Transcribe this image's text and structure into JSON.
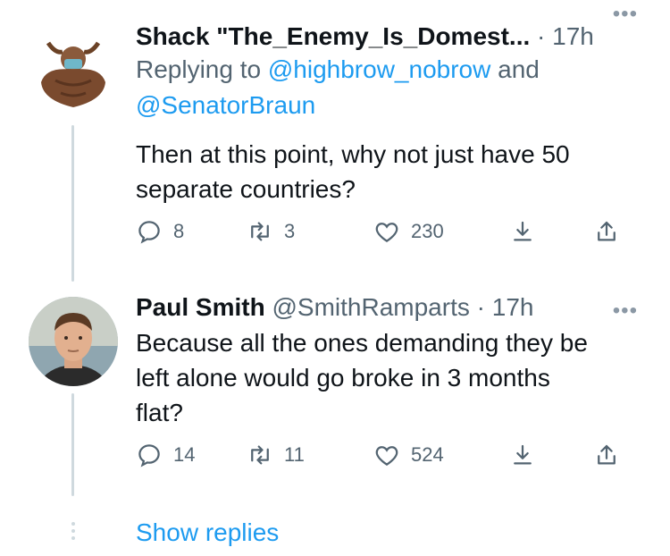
{
  "tweets": [
    {
      "display_name": "Shack \"The_Enemy_Is_Domest...",
      "handle": "",
      "time": "17h",
      "reply_prefix": "Replying to ",
      "reply_mention_1": "@highbrow_nobrow",
      "reply_and": " and",
      "reply_mention_2": "@SenatorBraun",
      "text_line1": "Then at this point, why not just have 50",
      "text_line2": "separate countries?",
      "replies": "8",
      "retweets": "3",
      "likes": "230"
    },
    {
      "display_name": "Paul Smith",
      "handle": "@SmithRamparts",
      "time": "17h",
      "text_line1": "Because all the ones demanding they be",
      "text_line2": "left alone would go broke in 3 months",
      "text_line3": "flat?",
      "replies": "14",
      "retweets": "11",
      "likes": "524"
    }
  ],
  "show_replies": "Show replies",
  "icons": [
    "more-icon",
    "reply-icon",
    "retweet-icon",
    "like-icon",
    "bookmark-icon",
    "share-icon"
  ],
  "colors": {
    "accent": "#1d9bf0",
    "muted": "#536471",
    "thread_line": "#cfd9de"
  }
}
